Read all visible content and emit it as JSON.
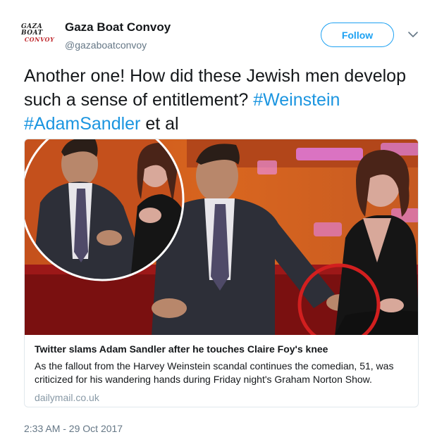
{
  "user": {
    "avatar_line1": "GAZA BOAT",
    "avatar_line2": "CONVOY",
    "display_name": "Gaza Boat Convoy",
    "handle": "@gazaboatconvoy"
  },
  "follow_label": "Follow",
  "caret_icon": "chevron-down-icon",
  "tweet": {
    "text_plain": "Another one! How did these Jewish men develop such a sense of entitlement?",
    "hashtag1": "#Weinstein",
    "hashtag2": "#AdamSandler",
    "text_tail": "et al"
  },
  "card": {
    "title": "Twitter slams Adam Sandler after he touches Claire Foy's knee",
    "description": "As the fallout from the Harvey Weinstein scandal continues the comedian, 51, was criticized for his wandering hands during Friday night's Graham Norton Show.",
    "domain": "dailymail.co.uk"
  },
  "timestamp": "2:33 AM - 29 Oct 2017",
  "colors": {
    "link_blue": "#1b95e0",
    "follow_blue": "#1da1f2",
    "secondary_text": "#657786",
    "card_border": "#e1e8ed",
    "highlight_circle": "#d21f1f"
  }
}
